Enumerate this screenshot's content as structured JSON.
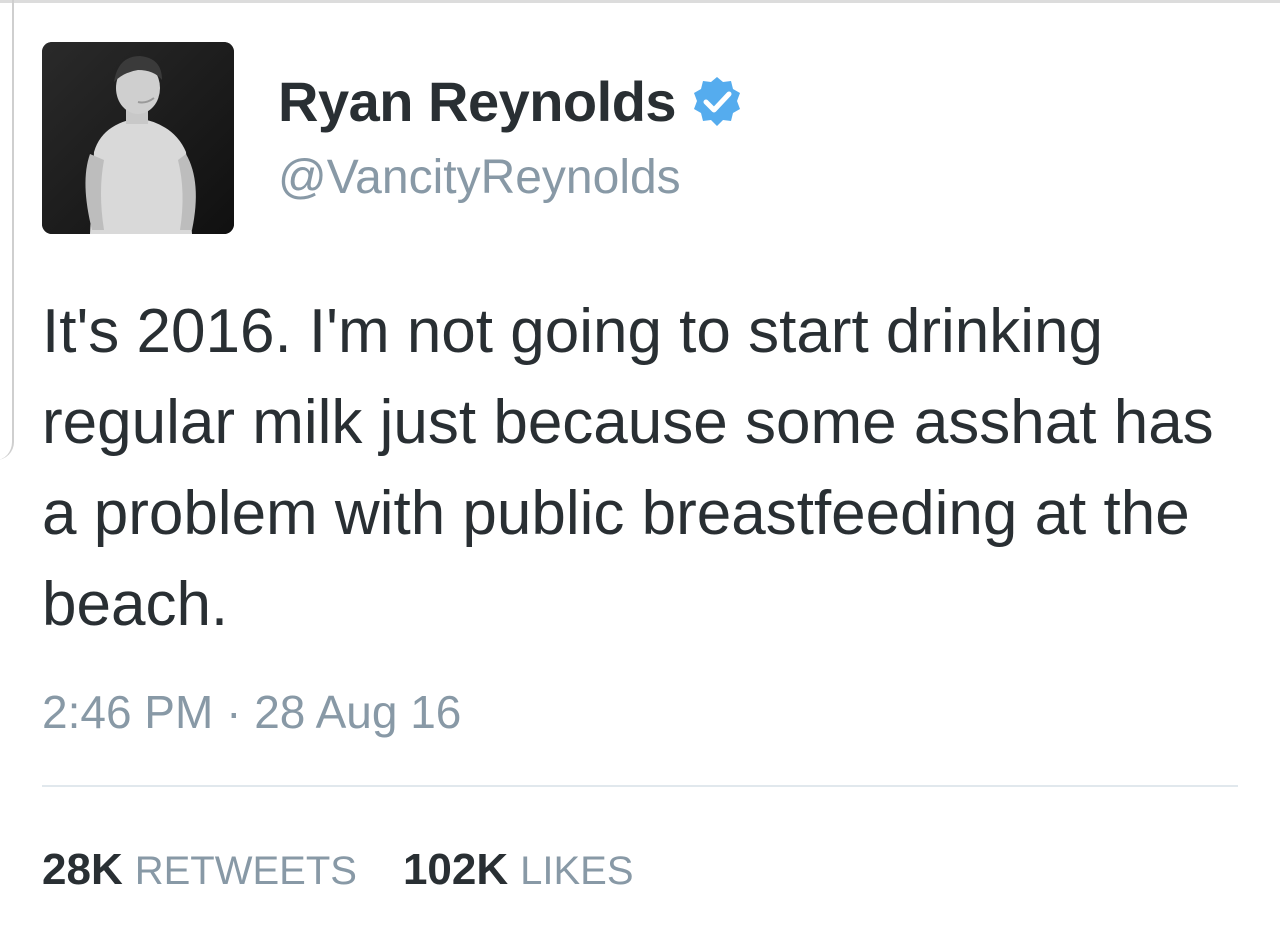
{
  "tweet": {
    "author": {
      "display_name": "Ryan Reynolds",
      "handle": "@VancityReynolds",
      "verified": true,
      "verified_icon": "verified-badge-icon",
      "avatar": "avatar-photo"
    },
    "text": "It's 2016. I'm not going to start drinking regular milk just because some asshat has a problem with public breastfeeding at the beach.",
    "timestamp": "2:46 PM · 28 Aug 16",
    "stats": {
      "retweets_count": "28K",
      "retweets_label": "RETWEETS",
      "likes_count": "102K",
      "likes_label": "LIKES"
    }
  },
  "colors": {
    "text_primary": "#292f33",
    "text_secondary": "#8899a6",
    "verified_blue": "#55acee",
    "divider": "#e1e8ed"
  }
}
